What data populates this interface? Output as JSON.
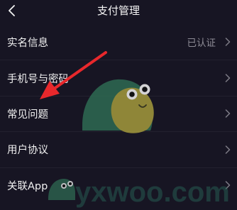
{
  "header": {
    "title": "支付管理"
  },
  "rows": [
    {
      "label": "实名信息",
      "value": "已认证"
    },
    {
      "label": "手机号与密码",
      "value": ""
    },
    {
      "label": "常见问题",
      "value": ""
    },
    {
      "label": "用户协议",
      "value": ""
    },
    {
      "label": "关联App",
      "value": ""
    }
  ],
  "watermark": {
    "text": "yxwoo.com"
  },
  "colors": {
    "background": "#171523",
    "text": "#f0f0f0",
    "muted": "#8e8c96",
    "chevron": "#7d7b86",
    "arrow": "#e8282c",
    "watermark_body": "#2e6a52",
    "watermark_shell": "#a59a3c"
  }
}
